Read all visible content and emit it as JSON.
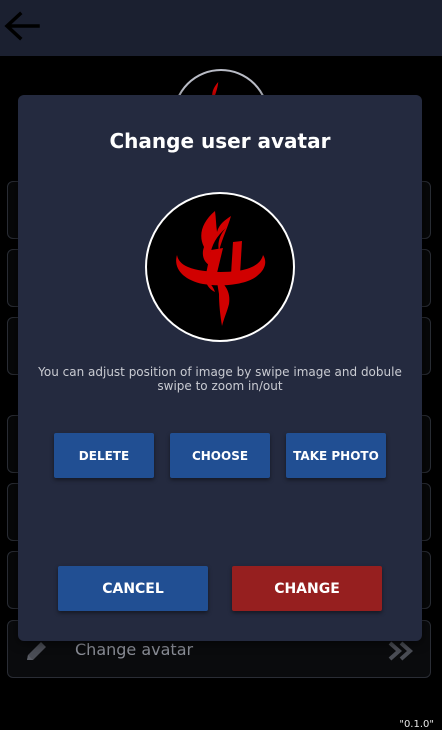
{
  "colors": {
    "topbar": "#1b2030",
    "modal_bg": "#242a3f",
    "primary_button": "#214f93",
    "danger_button": "#961f1f",
    "logo_red": "#d10000"
  },
  "icons": {
    "back": "arrow-left-icon",
    "edit": "pencil-icon",
    "forward": "double-chevron-right-icon",
    "logo": "flame-logo-icon"
  },
  "modal": {
    "title": "Change user avatar",
    "hint": "You can adjust position of image by swipe image and dobule swipe to zoom in/out",
    "buttons": {
      "delete": "DELETE",
      "choose": "CHOOSE",
      "take_photo": "TAKE PHOTO",
      "cancel": "CANCEL",
      "change": "CHANGE"
    }
  },
  "background": {
    "change_avatar_label": "Change avatar",
    "version": "\"0.1.0\""
  }
}
